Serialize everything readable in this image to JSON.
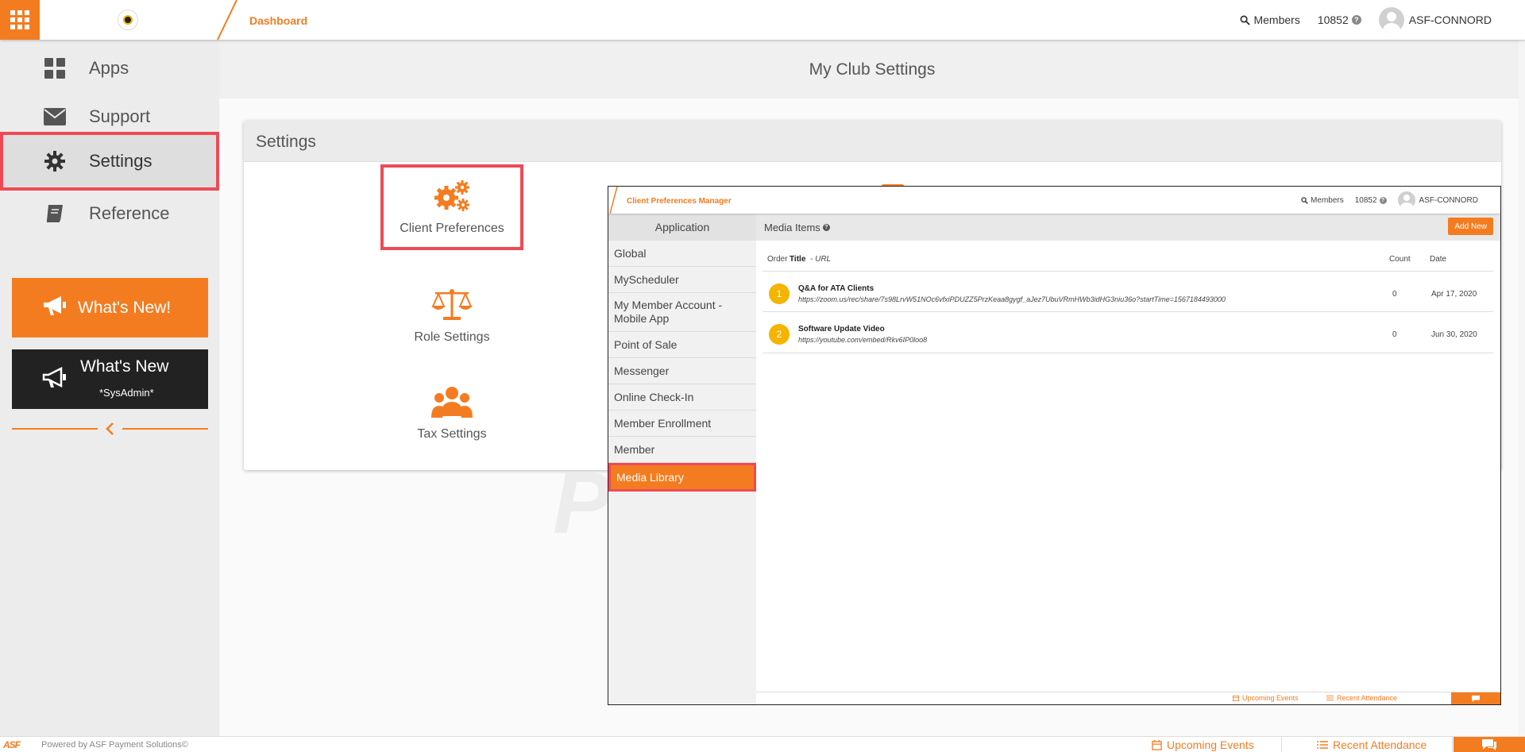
{
  "topbar": {
    "breadcrumb": "Dashboard",
    "members_label": "Members",
    "member_count": "10852",
    "user_name": "ASF-CONNORD"
  },
  "sidebar": {
    "items": [
      {
        "label": "Apps",
        "icon": "apps-icon"
      },
      {
        "label": "Support",
        "icon": "envelope-icon"
      },
      {
        "label": "Settings",
        "icon": "gear-icon"
      },
      {
        "label": "Reference",
        "icon": "book-icon"
      }
    ],
    "whats_new": "What's New!",
    "whats_new_admin": "What's New",
    "whats_new_admin_sub": "*SysAdmin*"
  },
  "main": {
    "title": "My Club Settings",
    "panel_title": "Settings",
    "tiles": [
      {
        "label": "Client Preferences"
      },
      {
        "label": "Role Settings"
      },
      {
        "label": "Tax Settings"
      }
    ]
  },
  "inset": {
    "breadcrumb": "Client Preferences Manager",
    "members_label": "Members",
    "member_count": "10852",
    "user_name": "ASF-CONNORD",
    "app_header": "Application",
    "app_items": [
      "Global",
      "MyScheduler",
      "My Member Account - Mobile App",
      "Point of Sale",
      "Messenger",
      "Online Check-In",
      "Member Enrollment",
      "Member",
      "Media Library"
    ],
    "media_title": "Media Items",
    "add_new": "Add New",
    "columns": {
      "order": "Order",
      "title": "Title",
      "url": "- URL",
      "count": "Count",
      "date": "Date"
    },
    "rows": [
      {
        "order": "1",
        "title": "Q&A for ATA Clients",
        "url": "https://zoom.us/rec/share/7s98LrvW51NOc6vfxiPDUZZ5PrzKeaa8gygf_aJez7UbuVRmHWb3idHG3niu36o?startTime=1567184493000",
        "count": "0",
        "date": "Apr 17, 2020"
      },
      {
        "order": "2",
        "title": "Software Update Video",
        "url": "https://youtube.com/embed/Rkv6IP0loo8",
        "count": "0",
        "date": "Jun 30, 2020"
      }
    ],
    "footer_events": "Upcoming Events",
    "footer_attendance": "Recent Attendance"
  },
  "footer": {
    "logo": "ASF",
    "powered": "Powered by ASF Payment Solutions©",
    "events": "Upcoming Events",
    "attendance": "Recent Attendance"
  },
  "colors": {
    "accent": "#f47c20",
    "highlight": "#ee4a56",
    "badge": "#f4b400"
  }
}
